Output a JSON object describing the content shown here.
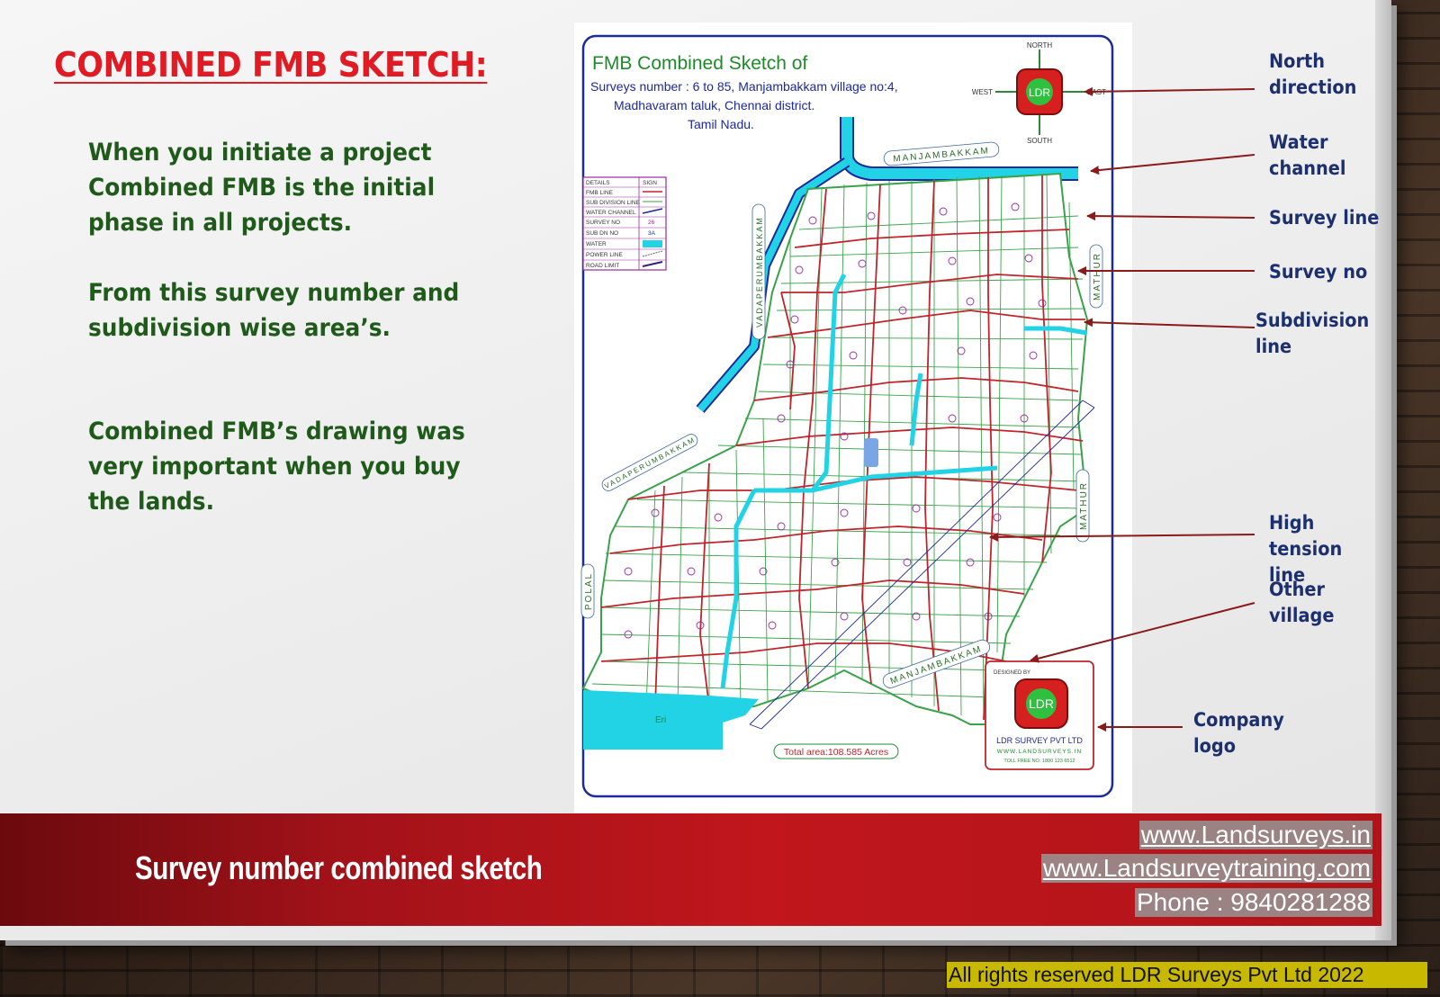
{
  "slide": {
    "title": "COMBINED FMB SKETCH:",
    "paragraphs": [
      "When you initiate a project Combined FMB is the initial phase in all projects.",
      "From this survey number and subdivision wise area’s.",
      "Combined FMB’s drawing was very important when you buy the lands."
    ]
  },
  "map": {
    "heading": "FMB Combined Sketch of",
    "subtitle_lines": [
      "Surveys number : 6 to 85, Manjambakkam village no:4,",
      "Madhavaram taluk, Chennai district.",
      "Tamil Nadu."
    ],
    "compass": {
      "north": "NORTH",
      "south": "SOUTH",
      "east": "EAST",
      "west": "WEST",
      "logo": "LDR"
    },
    "legend": {
      "header_left": "DETAILS",
      "header_right": "SIGN",
      "rows": [
        {
          "label": "FMB LINE",
          "sign": ""
        },
        {
          "label": "SUB DIVISION LINE",
          "sign": ""
        },
        {
          "label": "WATER CHANNEL",
          "sign": ""
        },
        {
          "label": "SURVEY NO",
          "sign": "26"
        },
        {
          "label": "SUB DN NO",
          "sign": "3A"
        },
        {
          "label": "WATER",
          "sign": ""
        },
        {
          "label": "POWER LINE",
          "sign": ""
        },
        {
          "label": "ROAD LIMIT",
          "sign": ""
        }
      ]
    },
    "village_labels": {
      "top": "MANJAMBAKKAM",
      "left_upper": "VADAPERUMBAKKAM",
      "left_mid": "VADAPERUMBAKKAM",
      "left_lower": "POLAL",
      "right_upper": "MATHUR",
      "right_lower": "MATHUR",
      "bottom": "MANJAMBAKKAM"
    },
    "eri_label": "Eri",
    "total_area": "Total area:108.585 Acres",
    "company": {
      "designed_by": "DESIGNED BY",
      "logo_text": "LDR",
      "name": "LDR SURVEY PVT LTD",
      "website": "WWW.LANDSURVEYS.IN",
      "tollfree": "TOLL FREE NO: 1800 123 6512"
    }
  },
  "callouts": [
    {
      "id": "north-direction",
      "text": "North\ndirection"
    },
    {
      "id": "water-channel",
      "text": "Water\nchannel"
    },
    {
      "id": "survey-line",
      "text": "Survey line"
    },
    {
      "id": "survey-no",
      "text": "Survey no"
    },
    {
      "id": "subdivision-line",
      "text": "Subdivision\nline"
    },
    {
      "id": "high-tension-line",
      "text": "High tension\nline"
    },
    {
      "id": "other-village",
      "text": "Other\nvillage"
    },
    {
      "id": "company-logo",
      "text": "Company\nlogo"
    }
  ],
  "banner": {
    "caption": "Survey number combined sketch",
    "website1": "www.Landsurveys.in",
    "website2": "www.Landsurveytraining.com",
    "phone": "Phone : 9840281288"
  },
  "copyright": "All rights reserved LDR Surveys Pvt Ltd 2022",
  "colors": {
    "title_red": "#e01b24",
    "body_green": "#1f5a1a",
    "callout_navy": "#1c2f6e",
    "banner_red": "#c0161c",
    "arrow_darkred": "#8b1a1a",
    "fmb_line": "#c0252b",
    "subdivision_line": "#3aa34a",
    "water": "#22d3e6",
    "border_blue": "#1b2a9c"
  }
}
